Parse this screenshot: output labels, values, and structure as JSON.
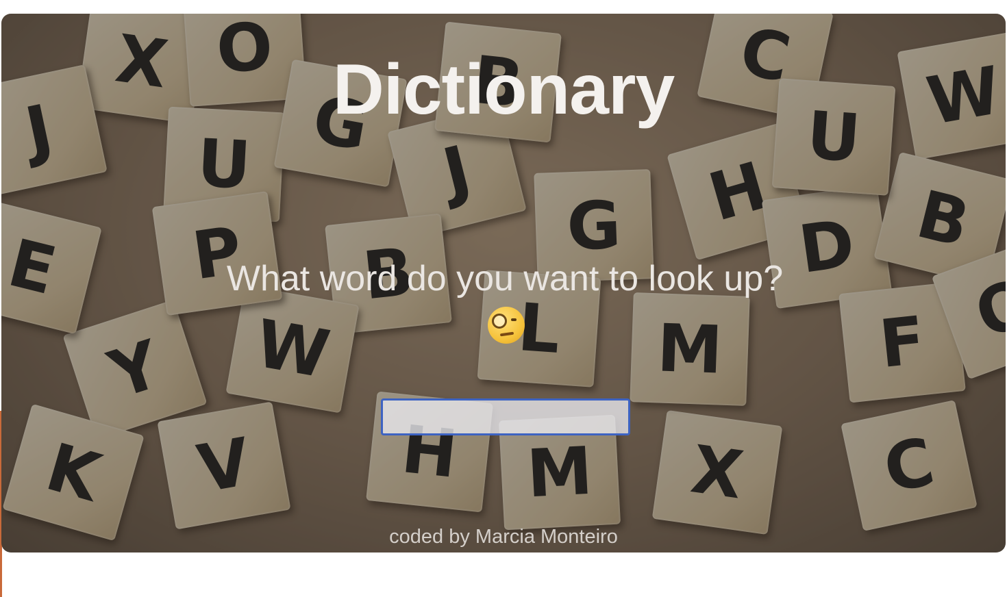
{
  "app": {
    "title": "Dictionary",
    "question": "What word do you want to look up?",
    "question_emoji": "face-with-monocle-icon",
    "search": {
      "value": "",
      "placeholder": ""
    },
    "footer": "coded by Marcia Monteiro"
  },
  "background": {
    "description_icon": "scrabble-tiles-background",
    "tiles": [
      "X",
      "O",
      "J",
      "U",
      "G",
      "J",
      "B",
      "G",
      "C",
      "W",
      "H",
      "D",
      "B",
      "F",
      "C",
      "X",
      "M",
      "M",
      "L",
      "B",
      "W",
      "Y",
      "K",
      "V",
      "H",
      "Q",
      "E",
      "P",
      "U"
    ]
  },
  "colors": {
    "accent": "#3d63c2",
    "title_text": "#f4f1ee",
    "body_text": "#eae6e2"
  }
}
